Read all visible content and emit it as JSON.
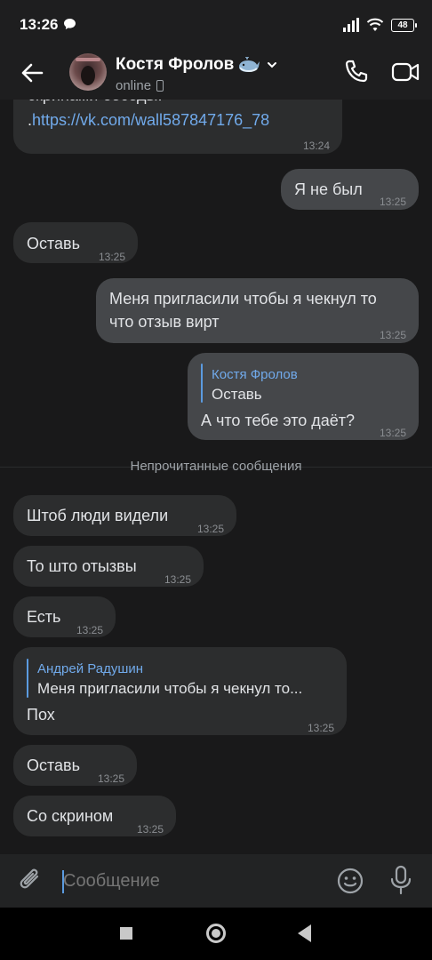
{
  "status_bar": {
    "time": "13:26",
    "battery": "48",
    "icons": [
      "message-bubble-icon",
      "signal-icon",
      "wifi-icon",
      "battery-icon"
    ]
  },
  "header": {
    "contact_name": "Костя Фролов",
    "status": "online",
    "icons": [
      "back-arrow-icon",
      "whale-emoji-icon",
      "chevron-down-icon",
      "mobile-phone-icon",
      "call-icon",
      "video-call-icon"
    ]
  },
  "messages": [
    {
      "id": "m0",
      "direction": "in",
      "text_partial": "скринами беседы.",
      "text_prefix": ".",
      "link": "https://vk.com/wall587847176_78",
      "time": "13:24"
    },
    {
      "id": "m1",
      "direction": "out",
      "text": "Я не был",
      "time": "13:25"
    },
    {
      "id": "m2",
      "direction": "in",
      "text": "Оставь",
      "time": "13:25"
    },
    {
      "id": "m3",
      "direction": "out",
      "line1": "Меня пригласили чтобы я чекнул то",
      "line2": "что отзыв вирт",
      "time": "13:25"
    },
    {
      "id": "m4",
      "direction": "out",
      "reply_name": "Костя Фролов",
      "reply_text": "Оставь",
      "text": "А что тебе это даёт?",
      "time": "13:25"
    },
    {
      "id": "m5",
      "direction": "in",
      "text": "Штоб люди видели",
      "time": "13:25"
    },
    {
      "id": "m6",
      "direction": "in",
      "text": "То што отызвы",
      "time": "13:25"
    },
    {
      "id": "m7",
      "direction": "in",
      "text": "Есть",
      "time": "13:25"
    },
    {
      "id": "m8",
      "direction": "in",
      "reply_name": "Андрей Радушин",
      "reply_text": "Меня пригласили чтобы я чекнул то...",
      "text": "Пох",
      "time": "13:25"
    },
    {
      "id": "m9",
      "direction": "in",
      "text": "Оставь",
      "time": "13:25"
    },
    {
      "id": "m10",
      "direction": "in",
      "text": "Со скрином",
      "time": "13:25"
    }
  ],
  "unread_divider": "Непрочитанные сообщения",
  "composer": {
    "placeholder": "Сообщение",
    "icons": [
      "attach-icon",
      "emoji-icon",
      "microphone-icon"
    ]
  },
  "colors": {
    "background": "#19191a",
    "incoming_bubble": "#2c2d2e",
    "outgoing_bubble": "#45474a",
    "accent": "#71aaeb"
  }
}
